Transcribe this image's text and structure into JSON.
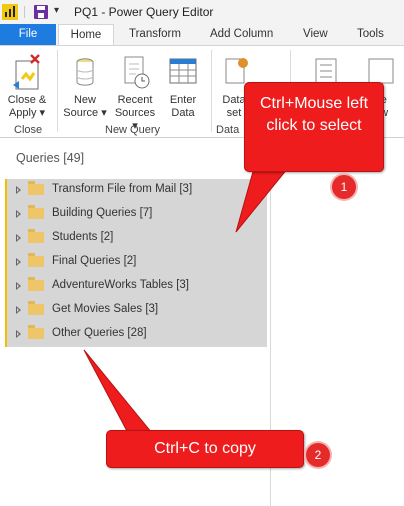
{
  "window": {
    "title": "PQ1 - Power Query Editor",
    "quick_access_dropdown": "▾"
  },
  "tabs": [
    {
      "label": "File"
    },
    {
      "label": "Home"
    },
    {
      "label": "Transform"
    },
    {
      "label": "Add Column"
    },
    {
      "label": "View"
    },
    {
      "label": "Tools"
    }
  ],
  "ribbon": {
    "close_apply": {
      "line1": "Close &",
      "line2": "Apply ▾"
    },
    "new_source": {
      "line1": "New",
      "line2": "Source ▾"
    },
    "recent_sources": {
      "line1": "Recent",
      "line2": "Sources ▾"
    },
    "enter_data": {
      "line1": "Enter",
      "line2": "Data"
    },
    "data_source_settings": {
      "line1": "Data",
      "line2": "set"
    },
    "refresh_preview": {
      "line1": "Refre",
      "line2": "eview"
    },
    "groups": {
      "close": "Close",
      "new_query": "New Query",
      "data": "Data"
    }
  },
  "queries_panel": {
    "title": "Queries [49]",
    "items": [
      {
        "label": "Transform File from Mail [3]"
      },
      {
        "label": "Building Queries [7]"
      },
      {
        "label": "Students [2]"
      },
      {
        "label": "Final Queries [2]"
      },
      {
        "label": "AdventureWorks Tables [3]"
      },
      {
        "label": "Get Movies Sales [3]"
      },
      {
        "label": "Other Queries [28]"
      }
    ]
  },
  "annotations": [
    {
      "text": "Ctrl+Mouse left click to select",
      "badge": "1"
    },
    {
      "text": "Ctrl+C to copy",
      "badge": "2"
    }
  ],
  "colors": {
    "file_tab": "#1e7be0",
    "selection_bar": "#f0c000",
    "callout": "#ee1c1c",
    "folder": "#efc56a",
    "powerbi_logo": "#f2c811"
  }
}
